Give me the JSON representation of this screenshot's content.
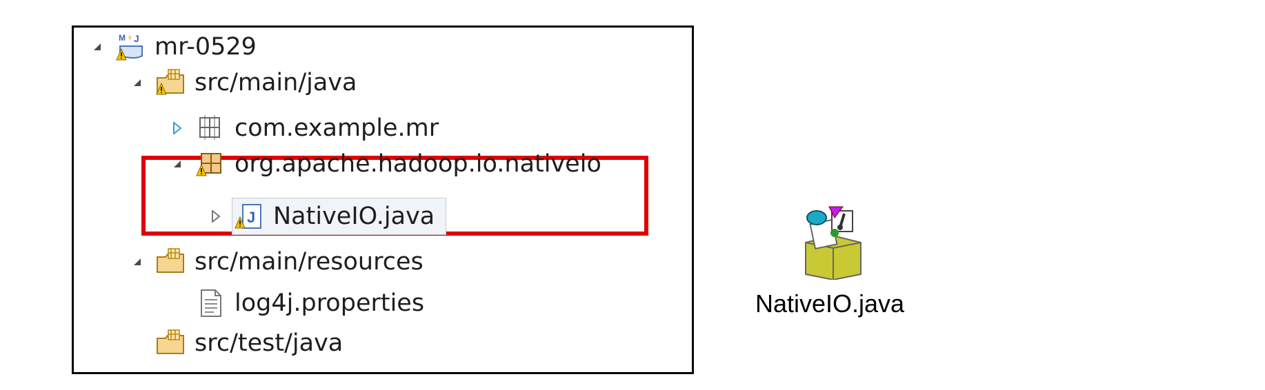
{
  "project_explorer": {
    "project": {
      "name": "mr-0529",
      "icon": "maven-project-icon"
    },
    "items": [
      {
        "label": "src/main/java",
        "icon": "source-folder-icon"
      },
      {
        "label": "com.example.mr",
        "icon": "package-icon"
      },
      {
        "label": "org.apache.hadoop.io.nativeio",
        "icon": "package-icon"
      },
      {
        "label": "NativeIO.java",
        "icon": "java-file-icon"
      },
      {
        "label": "src/main/resources",
        "icon": "source-folder-icon"
      },
      {
        "label": "log4j.properties",
        "icon": "text-file-icon"
      },
      {
        "label": "src/test/java",
        "icon": "source-folder-icon"
      }
    ]
  },
  "desktop_file": {
    "label": "NativeIO.java",
    "icon": "java-file-package-icon"
  },
  "colors": {
    "highlight_border": "#e00000",
    "tree_border": "#000000",
    "warning": "#f4c400"
  }
}
